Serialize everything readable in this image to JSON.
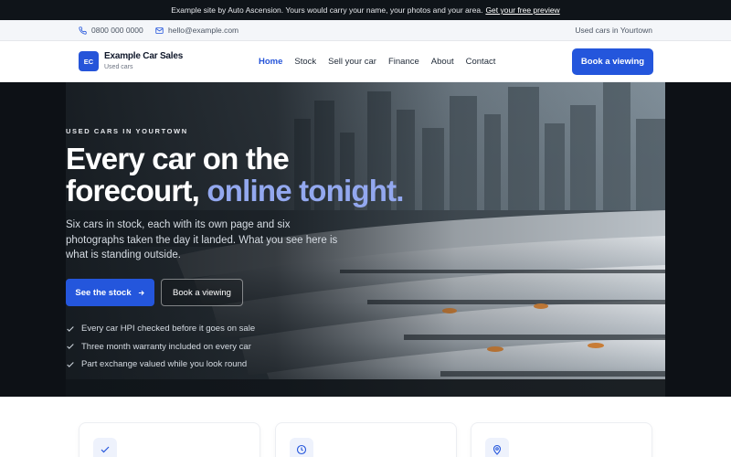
{
  "announcement": {
    "text": "Example site by Auto Ascension. Yours would carry your name, your photos and your area.",
    "link": "Get your free preview"
  },
  "contact": {
    "phone": "0800 000 0000",
    "email": "hello@example.com",
    "location": "Used cars in Yourtown"
  },
  "header": {
    "logo_initials": "EC",
    "brand_name": "Example Car Sales",
    "brand_sub": "Used cars",
    "nav": [
      "Home",
      "Stock",
      "Sell your car",
      "Finance",
      "About",
      "Contact"
    ],
    "active_nav": "Home",
    "cta": "Book a viewing"
  },
  "hero": {
    "eyebrow": "USED CARS IN YOURTOWN",
    "title_line1": "Every car on the",
    "title_line2": "forecourt,",
    "title_highlight": "online tonight.",
    "lede": "Six cars in stock, each with its own page and six photographs taken the day it landed. What you see here is what is standing outside.",
    "primary_button": "See the stock",
    "secondary_button": "Book a viewing",
    "checks": [
      "Every car HPI checked before it goes on sale",
      "Three month warranty included on every car",
      "Part exchange valued while you look round"
    ]
  },
  "colors": {
    "accent": "#2456dc",
    "highlight": "#93a8ef",
    "dark": "#0f1419"
  },
  "cards": {
    "icons": [
      "check-icon",
      "clock-icon",
      "location-pin-icon"
    ]
  }
}
